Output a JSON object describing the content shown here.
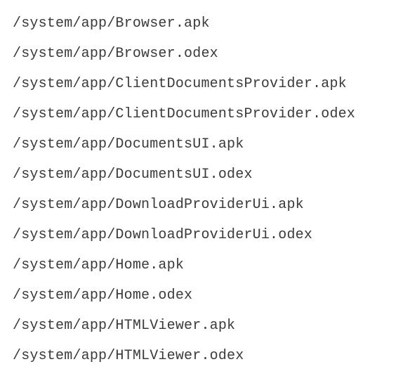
{
  "files": [
    "/system/app/Browser.apk",
    "/system/app/Browser.odex",
    "/system/app/ClientDocumentsProvider.apk",
    "/system/app/ClientDocumentsProvider.odex",
    "/system/app/DocumentsUI.apk",
    "/system/app/DocumentsUI.odex",
    "/system/app/DownloadProviderUi.apk",
    "/system/app/DownloadProviderUi.odex",
    "/system/app/Home.apk",
    "/system/app/Home.odex",
    "/system/app/HTMLViewer.apk",
    "/system/app/HTMLViewer.odex"
  ]
}
